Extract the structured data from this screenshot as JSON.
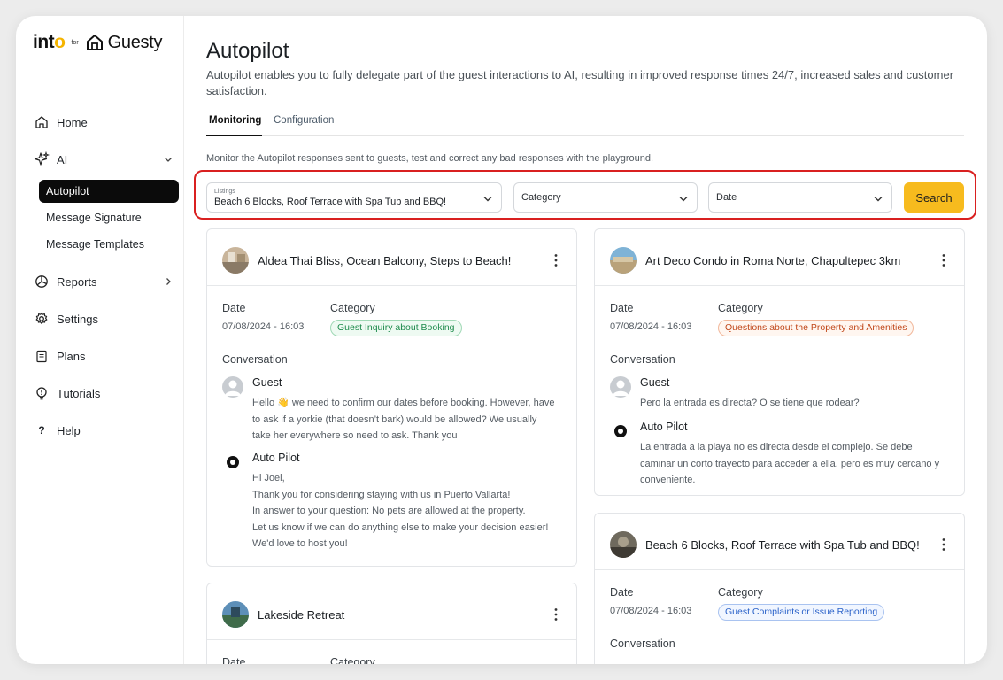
{
  "brand": {
    "into": "int",
    "into_o": "o",
    "for": "for",
    "guesty": "Guesty"
  },
  "sidebar": {
    "items": [
      {
        "label": "Home",
        "icon": "home-icon"
      },
      {
        "label": "AI",
        "icon": "sparkle-icon"
      },
      {
        "label": "Reports",
        "icon": "chart-pie-icon"
      },
      {
        "label": "Settings",
        "icon": "gear-icon"
      },
      {
        "label": "Plans",
        "icon": "clipboard-icon"
      },
      {
        "label": "Tutorials",
        "icon": "lightbulb-icon"
      },
      {
        "label": "Help",
        "icon": "question-icon"
      }
    ],
    "ai_subitems": [
      "Autopilot",
      "Message Signature",
      "Message Templates"
    ]
  },
  "page": {
    "title": "Autopilot",
    "description": "Autopilot enables you to fully delegate part of the guest interactions to AI, resulting in improved response times 24/7, increased sales and customer satisfaction.",
    "tabs": [
      "Monitoring",
      "Configuration"
    ],
    "monitor_description": "Monitor the Autopilot responses sent to guests, test and correct any bad responses with the playground."
  },
  "filters": {
    "listings_label": "Listings",
    "listings_value": "Beach 6 Blocks, Roof Terrace with Spa Tub and BBQ!",
    "category_placeholder": "Category",
    "date_placeholder": "Date",
    "search_label": "Search"
  },
  "labels": {
    "date": "Date",
    "category": "Category",
    "conversation": "Conversation",
    "guest": "Guest",
    "autopilot": "Auto Pilot"
  },
  "cards": [
    {
      "title": "Aldea Thai Bliss, Ocean Balcony, Steps to Beach!",
      "date": "07/08/2024 - 16:03",
      "category": "Guest Inquiry about Booking",
      "category_color": "#1e8a4c",
      "guest_lines": [
        "Hello 👋 we need to confirm our dates before booking. However, have",
        "to ask if a yorkie (that doesn’t bark) would be allowed? We usually",
        "take her everywhere so need to ask. Thank you"
      ],
      "autopilot_lines": [
        "Hi Joel,",
        "Thank you for considering staying with us in Puerto Vallarta!",
        "In answer to your question: No pets are allowed at the property.",
        "Let us know if we can do anything else to make your decision easier!",
        "We'd love to host you!"
      ]
    },
    {
      "title": "Art Deco Condo in Roma Norte, Chapultepec 3km",
      "date": "07/08/2024 - 16:03",
      "category": "Questions about the Property and Amenities",
      "category_color": "#c0471a",
      "guest_lines": [
        "Pero la entrada es directa? O se tiene que rodear?"
      ],
      "autopilot_lines": [
        "La entrada a la playa no es directa desde el complejo. Se debe",
        "caminar un corto trayecto para acceder a ella, pero es muy cercano y",
        "conveniente."
      ]
    },
    {
      "title": "Lakeside Retreat",
      "date_label": "Date",
      "category_label": "Category"
    },
    {
      "title": "Beach 6 Blocks, Roof Terrace with Spa Tub and BBQ!",
      "date": "07/08/2024 - 16:03",
      "category": "Guest Complaints or Issue Reporting",
      "category_color": "#2a62c9"
    }
  ]
}
